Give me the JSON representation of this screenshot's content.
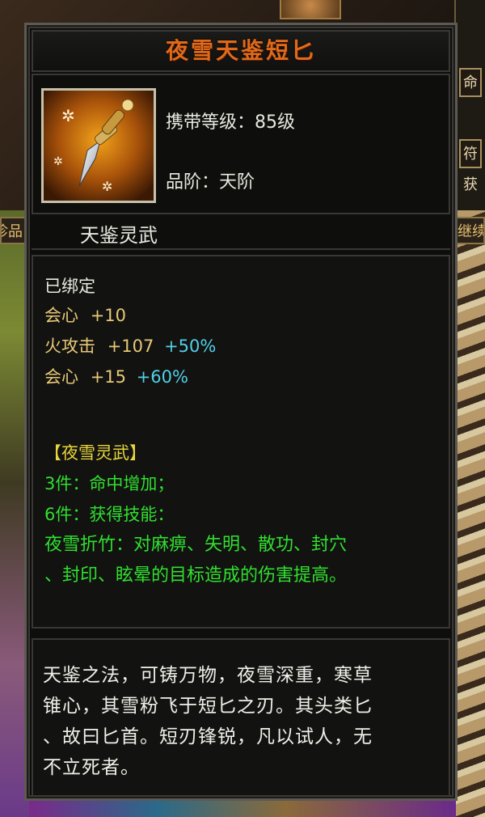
{
  "item": {
    "name": "夜雪天鉴短匕",
    "level_label": "携带等级：85级",
    "grade_label": "品阶：天阶",
    "category": "天鉴灵武",
    "icon": "dagger-icon"
  },
  "attributes": {
    "bound": "已绑定",
    "stats": [
      {
        "name": "会心",
        "value": "+10",
        "bonus": ""
      },
      {
        "name": "火攻击",
        "value": "+107",
        "bonus": "+50%"
      },
      {
        "name": "会心",
        "value": "+15",
        "bonus": "+60%"
      }
    ],
    "set": {
      "title": "【夜雪灵武】",
      "effects": [
        "3件：命中增加；",
        "6件：获得技能："
      ],
      "skill_lines": [
        "夜雪折竹：对麻痹、失明、散功、封穴",
        "、封印、眩晕的目标造成的伤害提高。"
      ]
    }
  },
  "description": {
    "lines": [
      "天鉴之法，可铸万物，夜雪深重，寒草",
      "锥心，其雪粉飞于短匕之刃。其头类匕",
      "、故曰匕首。短刃锋锐，凡以试人，无",
      "不立死者。"
    ]
  },
  "side": {
    "right_buttons": [
      "命",
      "符"
    ],
    "right_text": "获",
    "left_label": "珍品",
    "right_label": "继续"
  },
  "colors": {
    "title": "#e06a1a",
    "set_title": "#e8d63a",
    "set_text": "#30e030",
    "bonus": "#50d0e8",
    "fire_stat": "#e8c878"
  }
}
